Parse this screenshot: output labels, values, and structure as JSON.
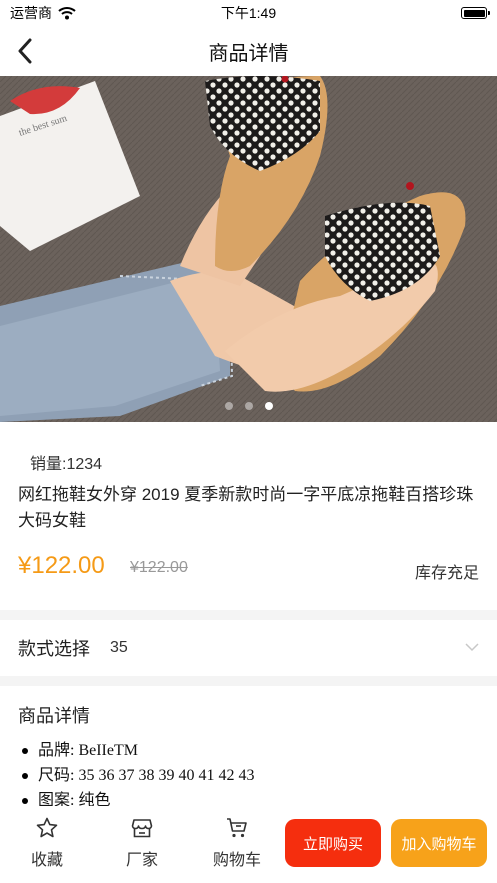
{
  "status": {
    "carrier": "运营商",
    "time": "下午1:49"
  },
  "nav": {
    "title": "商品详情",
    "back_icon": "chevron-left-icon"
  },
  "carousel": {
    "slide_count": 3,
    "active_index": 2
  },
  "product": {
    "sales": "销量:1234",
    "title": "网红拖鞋女外穿 2019 夏季新款时尚一字平底凉拖鞋百搭珍珠大码女鞋",
    "price": "¥122.00",
    "original_price": "¥122.00",
    "stock": "库存充足",
    "price_color": "#f59a16"
  },
  "style_select": {
    "label": "款式选择",
    "value": "35"
  },
  "details": {
    "title": "商品详情",
    "items": [
      "品牌: BeIIeTM",
      "尺码: 35 36 37 38 39 40 41 42 43",
      "图案: 纯色"
    ]
  },
  "tabbar": {
    "favorite": "收藏",
    "factory": "厂家",
    "cart": "购物车",
    "buy_now": "立即购买",
    "add_to_cart": "加入购物车",
    "buy_color": "#f52e0e",
    "cart_color": "#f7a21a"
  }
}
